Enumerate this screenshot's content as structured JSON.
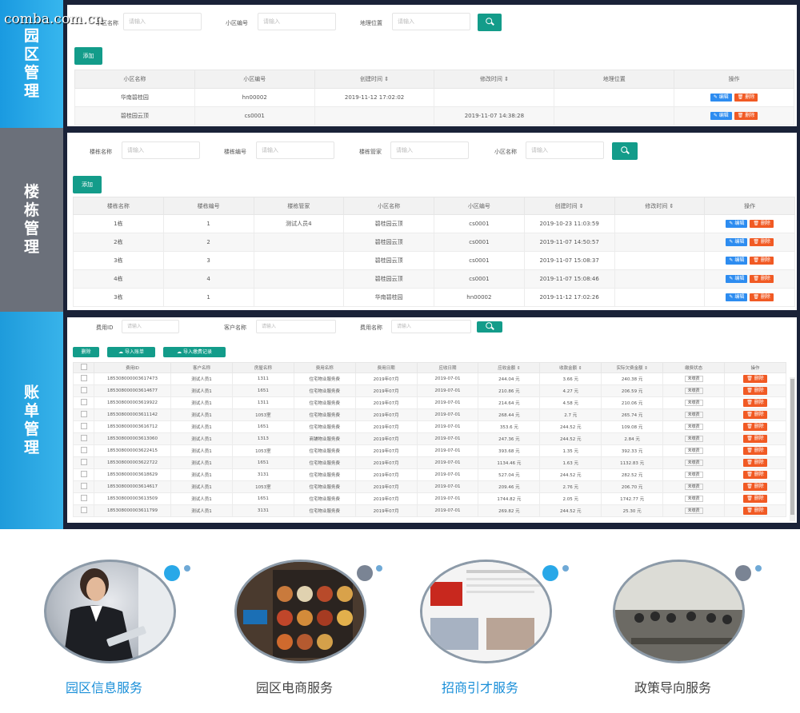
{
  "watermark": "comba.com.cn",
  "side_labels": [
    "园区管理",
    "楼栋管理",
    "账单管理"
  ],
  "section_park": {
    "filters": [
      {
        "label": "小区名称",
        "placeholder": "请输入"
      },
      {
        "label": "小区编号",
        "placeholder": "请输入"
      },
      {
        "label": "地理位置",
        "placeholder": "请输入"
      }
    ],
    "add_label": "添加",
    "columns": [
      "小区名称",
      "小区编号",
      "创建时间 ⇕",
      "修改时间 ⇕",
      "地理位置",
      "操作"
    ],
    "rows": [
      [
        "华南碧桂园",
        "hn00002",
        "2019-11-12 17:02:02",
        "",
        ""
      ],
      [
        "碧桂园云顶",
        "cs0001",
        "",
        "2019-11-07 14:38:28",
        ""
      ]
    ],
    "edit_label": "✎ 编辑",
    "delete_label": "🗑 删除"
  },
  "section_building": {
    "filters": [
      {
        "label": "楼栋名称",
        "placeholder": "请输入"
      },
      {
        "label": "楼栋编号",
        "placeholder": "请输入"
      },
      {
        "label": "楼栋管家",
        "placeholder": "请输入"
      },
      {
        "label": "小区名称",
        "placeholder": "请输入"
      }
    ],
    "add_label": "添加",
    "columns": [
      "楼栋名称",
      "楼栋编号",
      "楼栋管家",
      "小区名称",
      "小区编号",
      "创建时间 ⇕",
      "修改时间 ⇕",
      "操作"
    ],
    "rows": [
      [
        "1栋",
        "1",
        "测试人员4",
        "碧桂园云顶",
        "cs0001",
        "2019-10-23 11:03:59",
        ""
      ],
      [
        "2栋",
        "2",
        "",
        "碧桂园云顶",
        "cs0001",
        "2019-11-07 14:50:57",
        ""
      ],
      [
        "3栋",
        "3",
        "",
        "碧桂园云顶",
        "cs0001",
        "2019-11-07 15:08:37",
        ""
      ],
      [
        "4栋",
        "4",
        "",
        "碧桂园云顶",
        "cs0001",
        "2019-11-07 15:08:46",
        ""
      ],
      [
        "3栋",
        "1",
        "",
        "华南碧桂园",
        "hn00002",
        "2019-11-12 17:02:26",
        ""
      ]
    ],
    "edit_label": "✎ 编辑",
    "delete_label": "🗑 删除"
  },
  "section_billing": {
    "filters": [
      {
        "label": "费用ID",
        "placeholder": "请输入"
      },
      {
        "label": "客户名称",
        "placeholder": "请输入"
      },
      {
        "label": "费用名称",
        "placeholder": "请输入"
      }
    ],
    "buttons": {
      "delete": "删除",
      "import_fee": "导入账单",
      "import_pay": "导入缴费记录"
    },
    "columns": [
      "",
      "费用ID",
      "客户名称",
      "房屋名称",
      "费用名称",
      "费用日期",
      "应收日期",
      "应收金额 ⇕",
      "收款金额 ⇕",
      "实际欠费金额 ⇕",
      "缴费状态",
      "操作"
    ],
    "rows": [
      [
        "185308000003617473",
        "测试人员1",
        "1311",
        "住宅物业服务费",
        "2019年07月",
        "2019-07-01",
        "244.04 元",
        "3.66 元",
        "240.38 元",
        "未缴费"
      ],
      [
        "185308000003614677",
        "测试人员1",
        "1651",
        "住宅物业服务费",
        "2019年07月",
        "2019-07-01",
        "210.86 元",
        "4.27 元",
        "206.59 元",
        "未缴费"
      ],
      [
        "185308000003619922",
        "测试人员1",
        "1311",
        "住宅物业服务费",
        "2019年07月",
        "2019-07-01",
        "214.64 元",
        "4.58 元",
        "210.06 元",
        "未缴费"
      ],
      [
        "185308000003611142",
        "测试人员1",
        "1053室",
        "住宅物业服务费",
        "2019年07月",
        "2019-07-01",
        "268.44 元",
        "2.7 元",
        "265.74 元",
        "未缴费"
      ],
      [
        "185308000003616712",
        "测试人员1",
        "1651",
        "住宅物业服务费",
        "2019年07月",
        "2019-07-01",
        "353.6 元",
        "244.52 元",
        "109.08 元",
        "未缴费"
      ],
      [
        "185308000003613060",
        "测试人员1",
        "1313",
        "商铺物业服务费",
        "2019年07月",
        "2019-07-01",
        "247.36 元",
        "244.52 元",
        "2.84 元",
        "未缴费"
      ],
      [
        "185308000003622415",
        "测试人员1",
        "1053室",
        "住宅物业服务费",
        "2019年07月",
        "2019-07-01",
        "393.68 元",
        "1.35 元",
        "392.33 元",
        "未缴费"
      ],
      [
        "185308000003622722",
        "测试人员1",
        "1651",
        "住宅物业服务费",
        "2019年07月",
        "2019-07-01",
        "1134.46 元",
        "1.63 元",
        "1132.83 元",
        "未缴费"
      ],
      [
        "185308000003618629",
        "测试人员1",
        "3131",
        "住宅物业服务费",
        "2019年07月",
        "2019-07-01",
        "527.04 元",
        "244.52 元",
        "282.52 元",
        "未缴费"
      ],
      [
        "185308000003614617",
        "测试人员1",
        "1053室",
        "住宅物业服务费",
        "2019年07月",
        "2019-07-01",
        "209.46 元",
        "2.76 元",
        "206.70 元",
        "未缴费"
      ],
      [
        "185308000003613509",
        "测试人员1",
        "1651",
        "住宅物业服务费",
        "2019年07月",
        "2019-07-01",
        "1744.82 元",
        "2.05 元",
        "1742.77 元",
        "未缴费"
      ],
      [
        "185308000003611799",
        "测试人员1",
        "3131",
        "住宅物业服务费",
        "2019年07月",
        "2019-07-01",
        "269.82 元",
        "244.52 元",
        "25.30 元",
        "未缴费"
      ]
    ],
    "delete_label": "🗑 删除"
  },
  "services": [
    {
      "title": "园区信息服务",
      "color": "#1a8fd8",
      "dot_color": "#29a8e8"
    },
    {
      "title": "园区电商服务",
      "color": "#444444",
      "dot_color": "#7a8494"
    },
    {
      "title": "招商引才服务",
      "color": "#1a8fd8",
      "dot_color": "#29a8e8"
    },
    {
      "title": "政策导向服务",
      "color": "#444444",
      "dot_color": "#7a8494"
    }
  ]
}
